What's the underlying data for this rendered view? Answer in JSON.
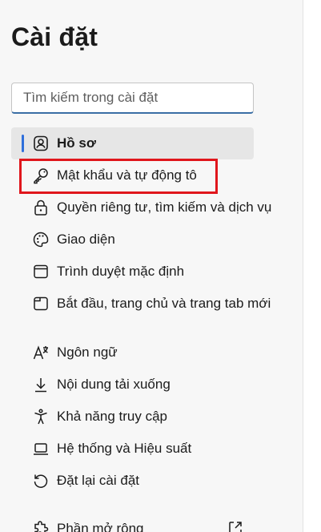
{
  "page": {
    "title": "Cài đặt"
  },
  "search": {
    "placeholder": "Tìm kiếm trong cài đặt"
  },
  "nav": {
    "items": [
      {
        "label": "Hồ sơ",
        "icon": "profile-icon",
        "active": true
      },
      {
        "label": "Mật khẩu và tự động tô",
        "icon": "key-icon",
        "active": false
      },
      {
        "label": "Quyền riêng tư, tìm kiếm và dịch vụ",
        "icon": "lock-icon",
        "active": false
      },
      {
        "label": "Giao diện",
        "icon": "palette-icon",
        "active": false
      },
      {
        "label": "Trình duyệt mặc định",
        "icon": "browser-window-icon",
        "active": false
      },
      {
        "label": "Bắt đầu, trang chủ và trang tab mới",
        "icon": "new-tab-icon",
        "active": false
      },
      {
        "label": "Ngôn ngữ",
        "icon": "language-icon",
        "active": false
      },
      {
        "label": "Nội dung tải xuống",
        "icon": "download-icon",
        "active": false
      },
      {
        "label": "Khả năng truy cập",
        "icon": "accessibility-icon",
        "active": false
      },
      {
        "label": "Hệ thống và Hiệu suất",
        "icon": "laptop-icon",
        "active": false
      },
      {
        "label": "Đặt lại cài đặt",
        "icon": "reset-icon",
        "active": false
      },
      {
        "label": "Phần mở rộng",
        "icon": "puzzle-icon",
        "active": false
      }
    ]
  },
  "colors": {
    "accent": "#2f6fdb",
    "highlight": "#e0161c",
    "sidebar_bg": "#f7f7f7",
    "active_bg": "#e6e6e6"
  }
}
